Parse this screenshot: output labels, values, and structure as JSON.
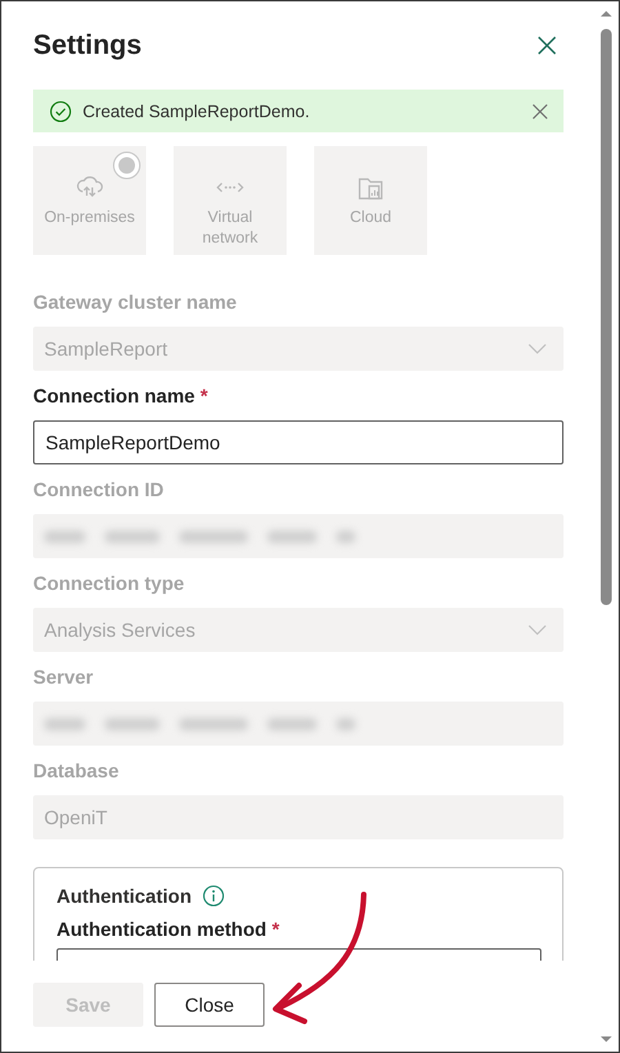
{
  "panel": {
    "title": "Settings"
  },
  "banner": {
    "message": "Created SampleReportDemo.",
    "kind": "success"
  },
  "gateway_types": [
    {
      "label": "On-premises",
      "selected": true
    },
    {
      "label": "Virtual network",
      "selected": false
    },
    {
      "label": "Cloud",
      "selected": false
    }
  ],
  "fields": [
    {
      "label": "Gateway cluster name",
      "disabled": true,
      "kind": "dropdown",
      "value": "SampleReport"
    },
    {
      "label": "Connection name",
      "required_mark": "*",
      "disabled": false,
      "kind": "text",
      "value": "SampleReportDemo"
    },
    {
      "label": "Connection ID",
      "disabled": true,
      "kind": "blurred"
    },
    {
      "label": "Connection type",
      "disabled": true,
      "kind": "dropdown",
      "value": "Analysis Services"
    },
    {
      "label": "Server",
      "disabled": true,
      "kind": "blurred"
    },
    {
      "label": "Database",
      "disabled": true,
      "kind": "text",
      "value": "OpeniT"
    }
  ],
  "authentication": {
    "title": "Authentication",
    "method_label": "Authentication method",
    "method_required_mark": "*"
  },
  "buttons": [
    {
      "label": "Save",
      "disabled": true
    },
    {
      "label": "Close",
      "disabled": false
    }
  ],
  "annotation": {
    "kind": "arrow"
  }
}
